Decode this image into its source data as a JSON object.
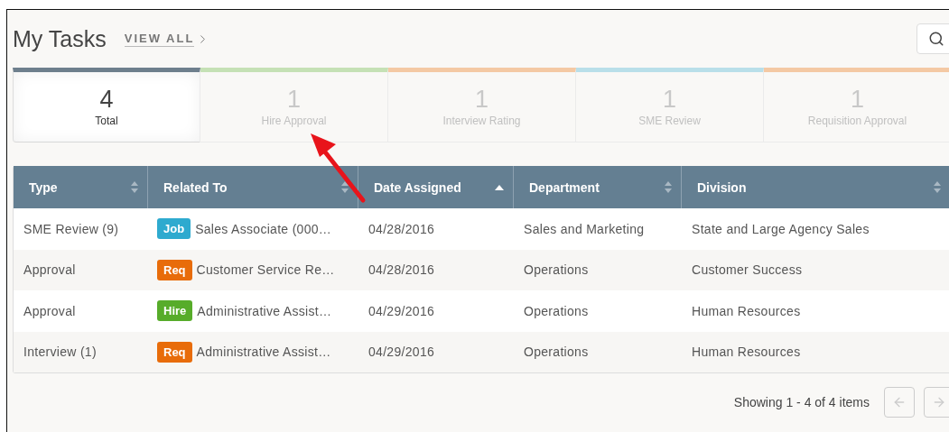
{
  "title": "My Tasks",
  "view_all": "VIEW ALL",
  "tiles": [
    {
      "count": "4",
      "label": "Total",
      "color": "#6e7f8d",
      "selected": true
    },
    {
      "count": "1",
      "label": "Hire Approval",
      "color": "#c5e1b5",
      "selected": false
    },
    {
      "count": "1",
      "label": "Interview Rating",
      "color": "#f4c9a4",
      "selected": false
    },
    {
      "count": "1",
      "label": "SME Review",
      "color": "#b9dfe9",
      "selected": false
    },
    {
      "count": "1",
      "label": "Requisition Approval",
      "color": "#f4c9a4",
      "selected": false
    }
  ],
  "columns": [
    {
      "label": "Type",
      "sorted": false
    },
    {
      "label": "Related To",
      "sorted": false
    },
    {
      "label": "Date Assigned",
      "sorted": true
    },
    {
      "label": "Department",
      "sorted": false
    },
    {
      "label": "Division",
      "sorted": false
    }
  ],
  "rows": [
    {
      "type": "SME Review (9)",
      "tag": {
        "label": "Job",
        "color": "#2eaacf"
      },
      "related": "Sales Associate (000…",
      "date": "04/28/2016",
      "department": "Sales and Marketing",
      "division": "State and Large Agency Sales"
    },
    {
      "type": "Approval",
      "tag": {
        "label": "Req",
        "color": "#e86c0a"
      },
      "related": "Customer Service Re…",
      "date": "04/28/2016",
      "department": "Operations",
      "division": "Customer Success"
    },
    {
      "type": "Approval",
      "tag": {
        "label": "Hire",
        "color": "#57ac2a"
      },
      "related": "Administrative Assist…",
      "date": "04/29/2016",
      "department": "Operations",
      "division": "Human Resources"
    },
    {
      "type": "Interview (1)",
      "tag": {
        "label": "Req",
        "color": "#e86c0a"
      },
      "related": "Administrative Assist…",
      "date": "04/29/2016",
      "department": "Operations",
      "division": "Human Resources"
    }
  ],
  "pager": {
    "summary": "Showing 1 - 4 of 4 items",
    "prev_disabled": true,
    "next_disabled": true
  }
}
